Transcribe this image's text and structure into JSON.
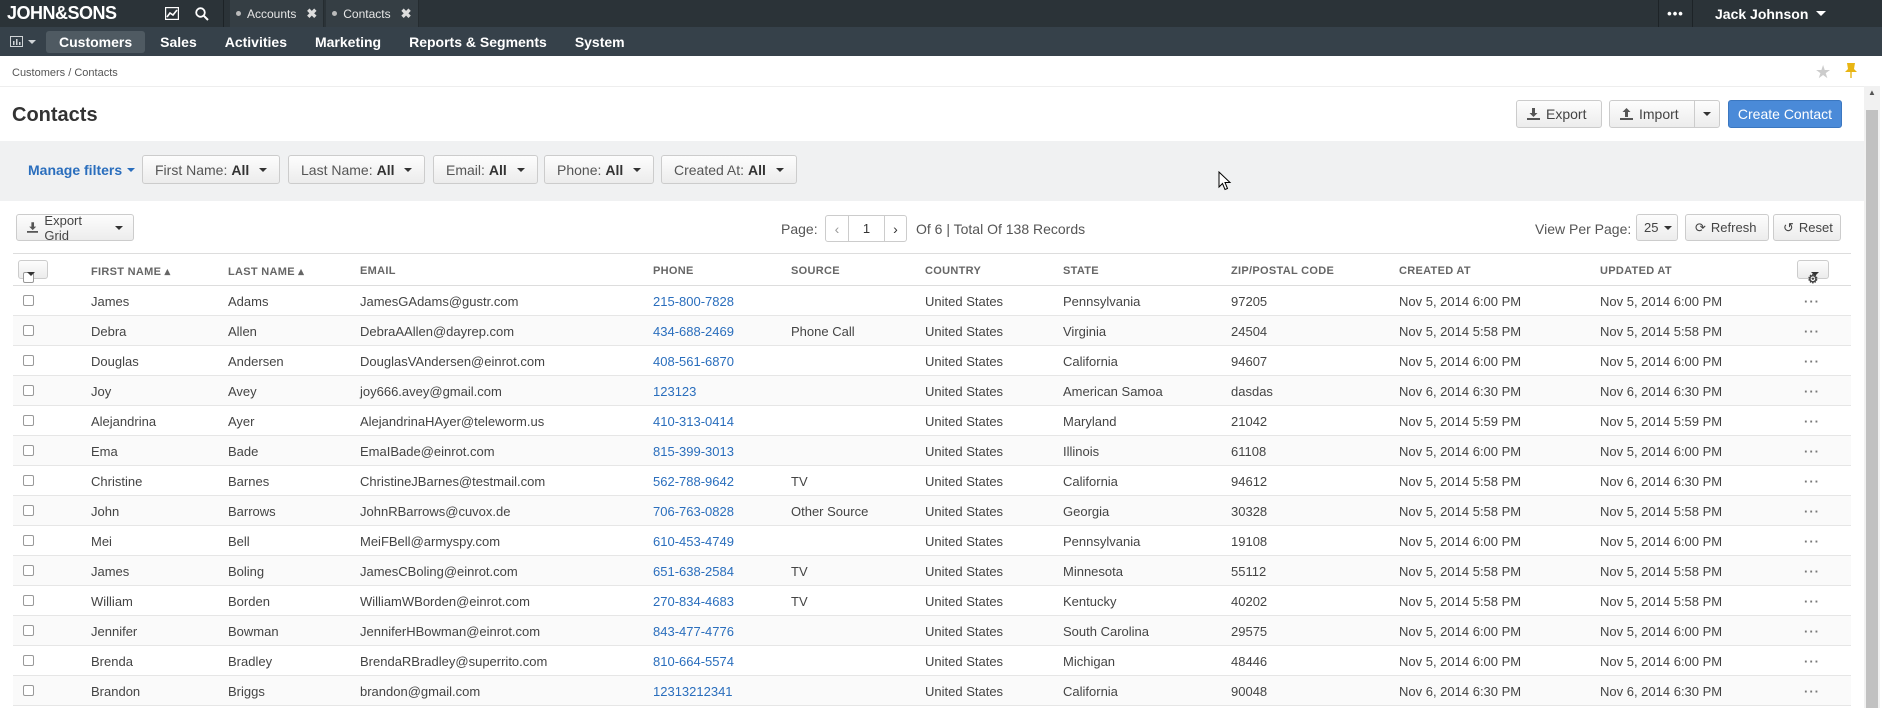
{
  "topbar": {
    "logo": "JOHN&SONS",
    "pinned_tabs": [
      {
        "label": "Accounts"
      },
      {
        "label": "Contacts"
      }
    ],
    "more_label": "•••",
    "user_name": "Jack Johnson"
  },
  "nav": {
    "items": [
      {
        "label": "Customers"
      },
      {
        "label": "Sales"
      },
      {
        "label": "Activities"
      },
      {
        "label": "Marketing"
      },
      {
        "label": "Reports & Segments"
      },
      {
        "label": "System"
      }
    ]
  },
  "breadcrumb": "Customers / Contacts",
  "page": {
    "title": "Contacts",
    "export_label": "Export",
    "import_label": "Import",
    "create_label": "Create Contact"
  },
  "filters": {
    "manage_label": "Manage filters",
    "items": [
      {
        "name": "First Name:",
        "value": "All"
      },
      {
        "name": "Last Name:",
        "value": "All"
      },
      {
        "name": "Email:",
        "value": "All"
      },
      {
        "name": "Phone:",
        "value": "All"
      },
      {
        "name": "Created At:",
        "value": "All"
      }
    ]
  },
  "grid_toolbar": {
    "export_grid_label": "Export Grid",
    "page_label": "Page:",
    "page_value": "1",
    "page_info": "Of 6 | Total Of 138 Records",
    "view_per_page_label": "View Per Page:",
    "view_per_page_value": "25",
    "refresh_label": "Refresh",
    "reset_label": "Reset"
  },
  "table": {
    "headers": [
      "FIRST NAME",
      "LAST NAME",
      "EMAIL",
      "PHONE",
      "SOURCE",
      "COUNTRY",
      "STATE",
      "ZIP/POSTAL CODE",
      "CREATED AT",
      "UPDATED AT"
    ],
    "rows": [
      [
        "James",
        "Adams",
        "JamesGAdams@gustr.com",
        "215-800-7828",
        "",
        "United States",
        "Pennsylvania",
        "97205",
        "Nov 5, 2014 6:00 PM",
        "Nov 5, 2014 6:00 PM"
      ],
      [
        "Debra",
        "Allen",
        "DebraAAllen@dayrep.com",
        "434-688-2469",
        "Phone Call",
        "United States",
        "Virginia",
        "24504",
        "Nov 5, 2014 5:58 PM",
        "Nov 5, 2014 5:58 PM"
      ],
      [
        "Douglas",
        "Andersen",
        "DouglasVAndersen@einrot.com",
        "408-561-6870",
        "",
        "United States",
        "California",
        "94607",
        "Nov 5, 2014 6:00 PM",
        "Nov 5, 2014 6:00 PM"
      ],
      [
        "Joy",
        "Avey",
        "joy666.avey@gmail.com",
        "123123",
        "",
        "United States",
        "American Samoa",
        "dasdas",
        "Nov 6, 2014 6:30 PM",
        "Nov 6, 2014 6:30 PM"
      ],
      [
        "Alejandrina",
        "Ayer",
        "AlejandrinaHAyer@teleworm.us",
        "410-313-0414",
        "",
        "United States",
        "Maryland",
        "21042",
        "Nov 5, 2014 5:59 PM",
        "Nov 5, 2014 5:59 PM"
      ],
      [
        "Ema",
        "Bade",
        "EmaIBade@einrot.com",
        "815-399-3013",
        "",
        "United States",
        "Illinois",
        "61108",
        "Nov 5, 2014 6:00 PM",
        "Nov 5, 2014 6:00 PM"
      ],
      [
        "Christine",
        "Barnes",
        "ChristineJBarnes@testmail.com",
        "562-788-9642",
        "TV",
        "United States",
        "California",
        "94612",
        "Nov 5, 2014 5:58 PM",
        "Nov 6, 2014 6:30 PM"
      ],
      [
        "John",
        "Barrows",
        "JohnRBarrows@cuvox.de",
        "706-763-0828",
        "Other Source",
        "United States",
        "Georgia",
        "30328",
        "Nov 5, 2014 5:58 PM",
        "Nov 5, 2014 5:58 PM"
      ],
      [
        "Mei",
        "Bell",
        "MeiFBell@armyspy.com",
        "610-453-4749",
        "",
        "United States",
        "Pennsylvania",
        "19108",
        "Nov 5, 2014 6:00 PM",
        "Nov 5, 2014 6:00 PM"
      ],
      [
        "James",
        "Boling",
        "JamesCBoling@einrot.com",
        "651-638-2584",
        "TV",
        "United States",
        "Minnesota",
        "55112",
        "Nov 5, 2014 5:58 PM",
        "Nov 5, 2014 5:58 PM"
      ],
      [
        "William",
        "Borden",
        "WilliamWBorden@einrot.com",
        "270-834-4683",
        "TV",
        "United States",
        "Kentucky",
        "40202",
        "Nov 5, 2014 5:58 PM",
        "Nov 5, 2014 5:58 PM"
      ],
      [
        "Jennifer",
        "Bowman",
        "JenniferHBowman@einrot.com",
        "843-477-4776",
        "",
        "United States",
        "South Carolina",
        "29575",
        "Nov 5, 2014 6:00 PM",
        "Nov 5, 2014 6:00 PM"
      ],
      [
        "Brenda",
        "Bradley",
        "BrendaRBradley@superrito.com",
        "810-664-5574",
        "",
        "United States",
        "Michigan",
        "48446",
        "Nov 5, 2014 6:00 PM",
        "Nov 5, 2014 6:00 PM"
      ],
      [
        "Brandon",
        "Briggs",
        "brandon@gmail.com",
        "12313212341",
        "",
        "United States",
        "California",
        "90048",
        "Nov 6, 2014 6:30 PM",
        "Nov 6, 2014 6:30 PM"
      ]
    ]
  },
  "colors": {
    "topbar": "#2b3338",
    "navbar": "#36414a",
    "primary": "#4a8ad8",
    "link": "#2a6ebd",
    "pin": "#e8b513"
  }
}
